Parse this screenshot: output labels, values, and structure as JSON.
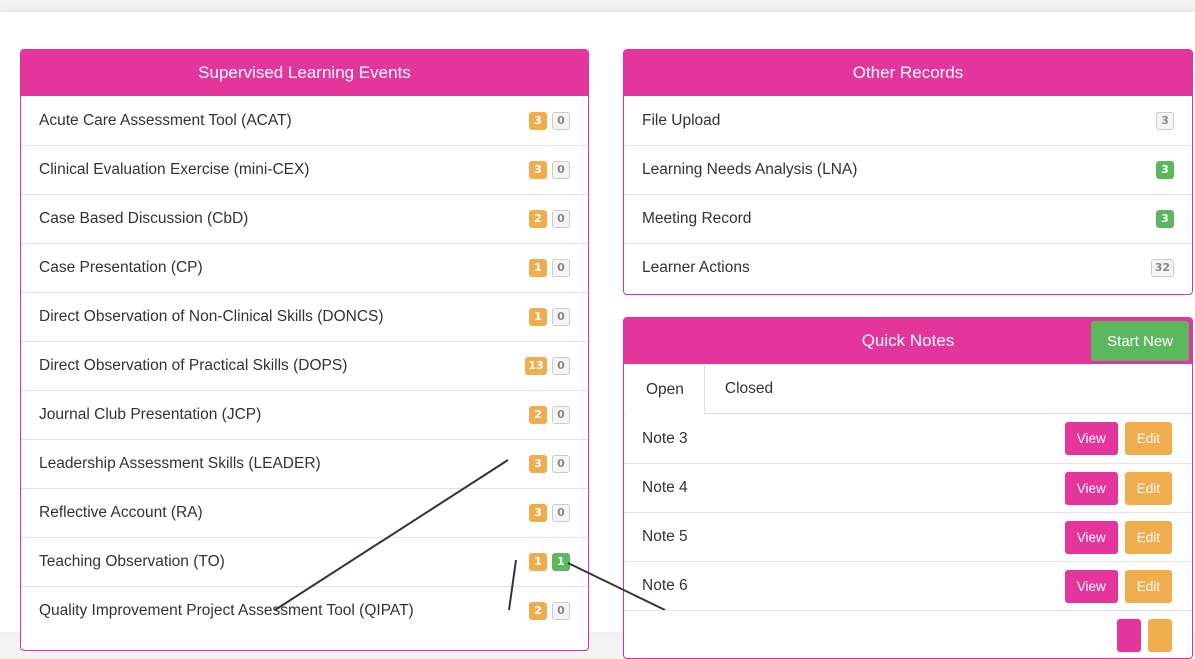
{
  "supervised_learning_events": {
    "title": "Supervised Learning Events",
    "items": [
      {
        "label": "Acute Care Assessment Tool (ACAT)",
        "badge1": "3",
        "badge2": "0"
      },
      {
        "label": "Clinical Evaluation Exercise (mini-CEX)",
        "badge1": "3",
        "badge2": "0"
      },
      {
        "label": "Case Based Discussion (CbD)",
        "badge1": "2",
        "badge2": "0"
      },
      {
        "label": "Case Presentation (CP)",
        "badge1": "1",
        "badge2": "0"
      },
      {
        "label": "Direct Observation of Non-Clinical Skills (DONCS)",
        "badge1": "1",
        "badge2": "0"
      },
      {
        "label": "Direct Observation of Practical Skills (DOPS)",
        "badge1": "13",
        "badge2": "0"
      },
      {
        "label": "Journal Club Presentation (JCP)",
        "badge1": "2",
        "badge2": "0"
      },
      {
        "label": "Leadership Assessment Skills (LEADER)",
        "badge1": "3",
        "badge2": "0"
      },
      {
        "label": "Reflective Account (RA)",
        "badge1": "3",
        "badge2": "0"
      },
      {
        "label": "Teaching Observation (TO)",
        "badge1": "1",
        "badge2": "1"
      },
      {
        "label": "Quality Improvement Project Assessment Tool (QIPAT)",
        "badge1": "2",
        "badge2": "0"
      }
    ]
  },
  "other_records": {
    "title": "Other Records",
    "items": [
      {
        "label": "File Upload",
        "count": "3",
        "style": "grey"
      },
      {
        "label": "Learning Needs Analysis (LNA)",
        "count": "3",
        "style": "green"
      },
      {
        "label": "Meeting Record",
        "count": "3",
        "style": "green"
      },
      {
        "label": "Learner Actions",
        "count": "32",
        "style": "grey"
      }
    ]
  },
  "quick_notes": {
    "title": "Quick Notes",
    "start_new_label": "Start New",
    "tabs": [
      "Open",
      "Closed"
    ],
    "active_tab": "Open",
    "view_label": "View",
    "edit_label": "Edit",
    "notes": [
      "Note 3",
      "Note 4",
      "Note 5",
      "Note 6"
    ]
  },
  "colors": {
    "header": "#e4359c",
    "badge_orange": "#f0ad4e",
    "badge_green": "#5cb85c",
    "view_button": "#e4359c",
    "edit_button": "#f0ad4e"
  }
}
